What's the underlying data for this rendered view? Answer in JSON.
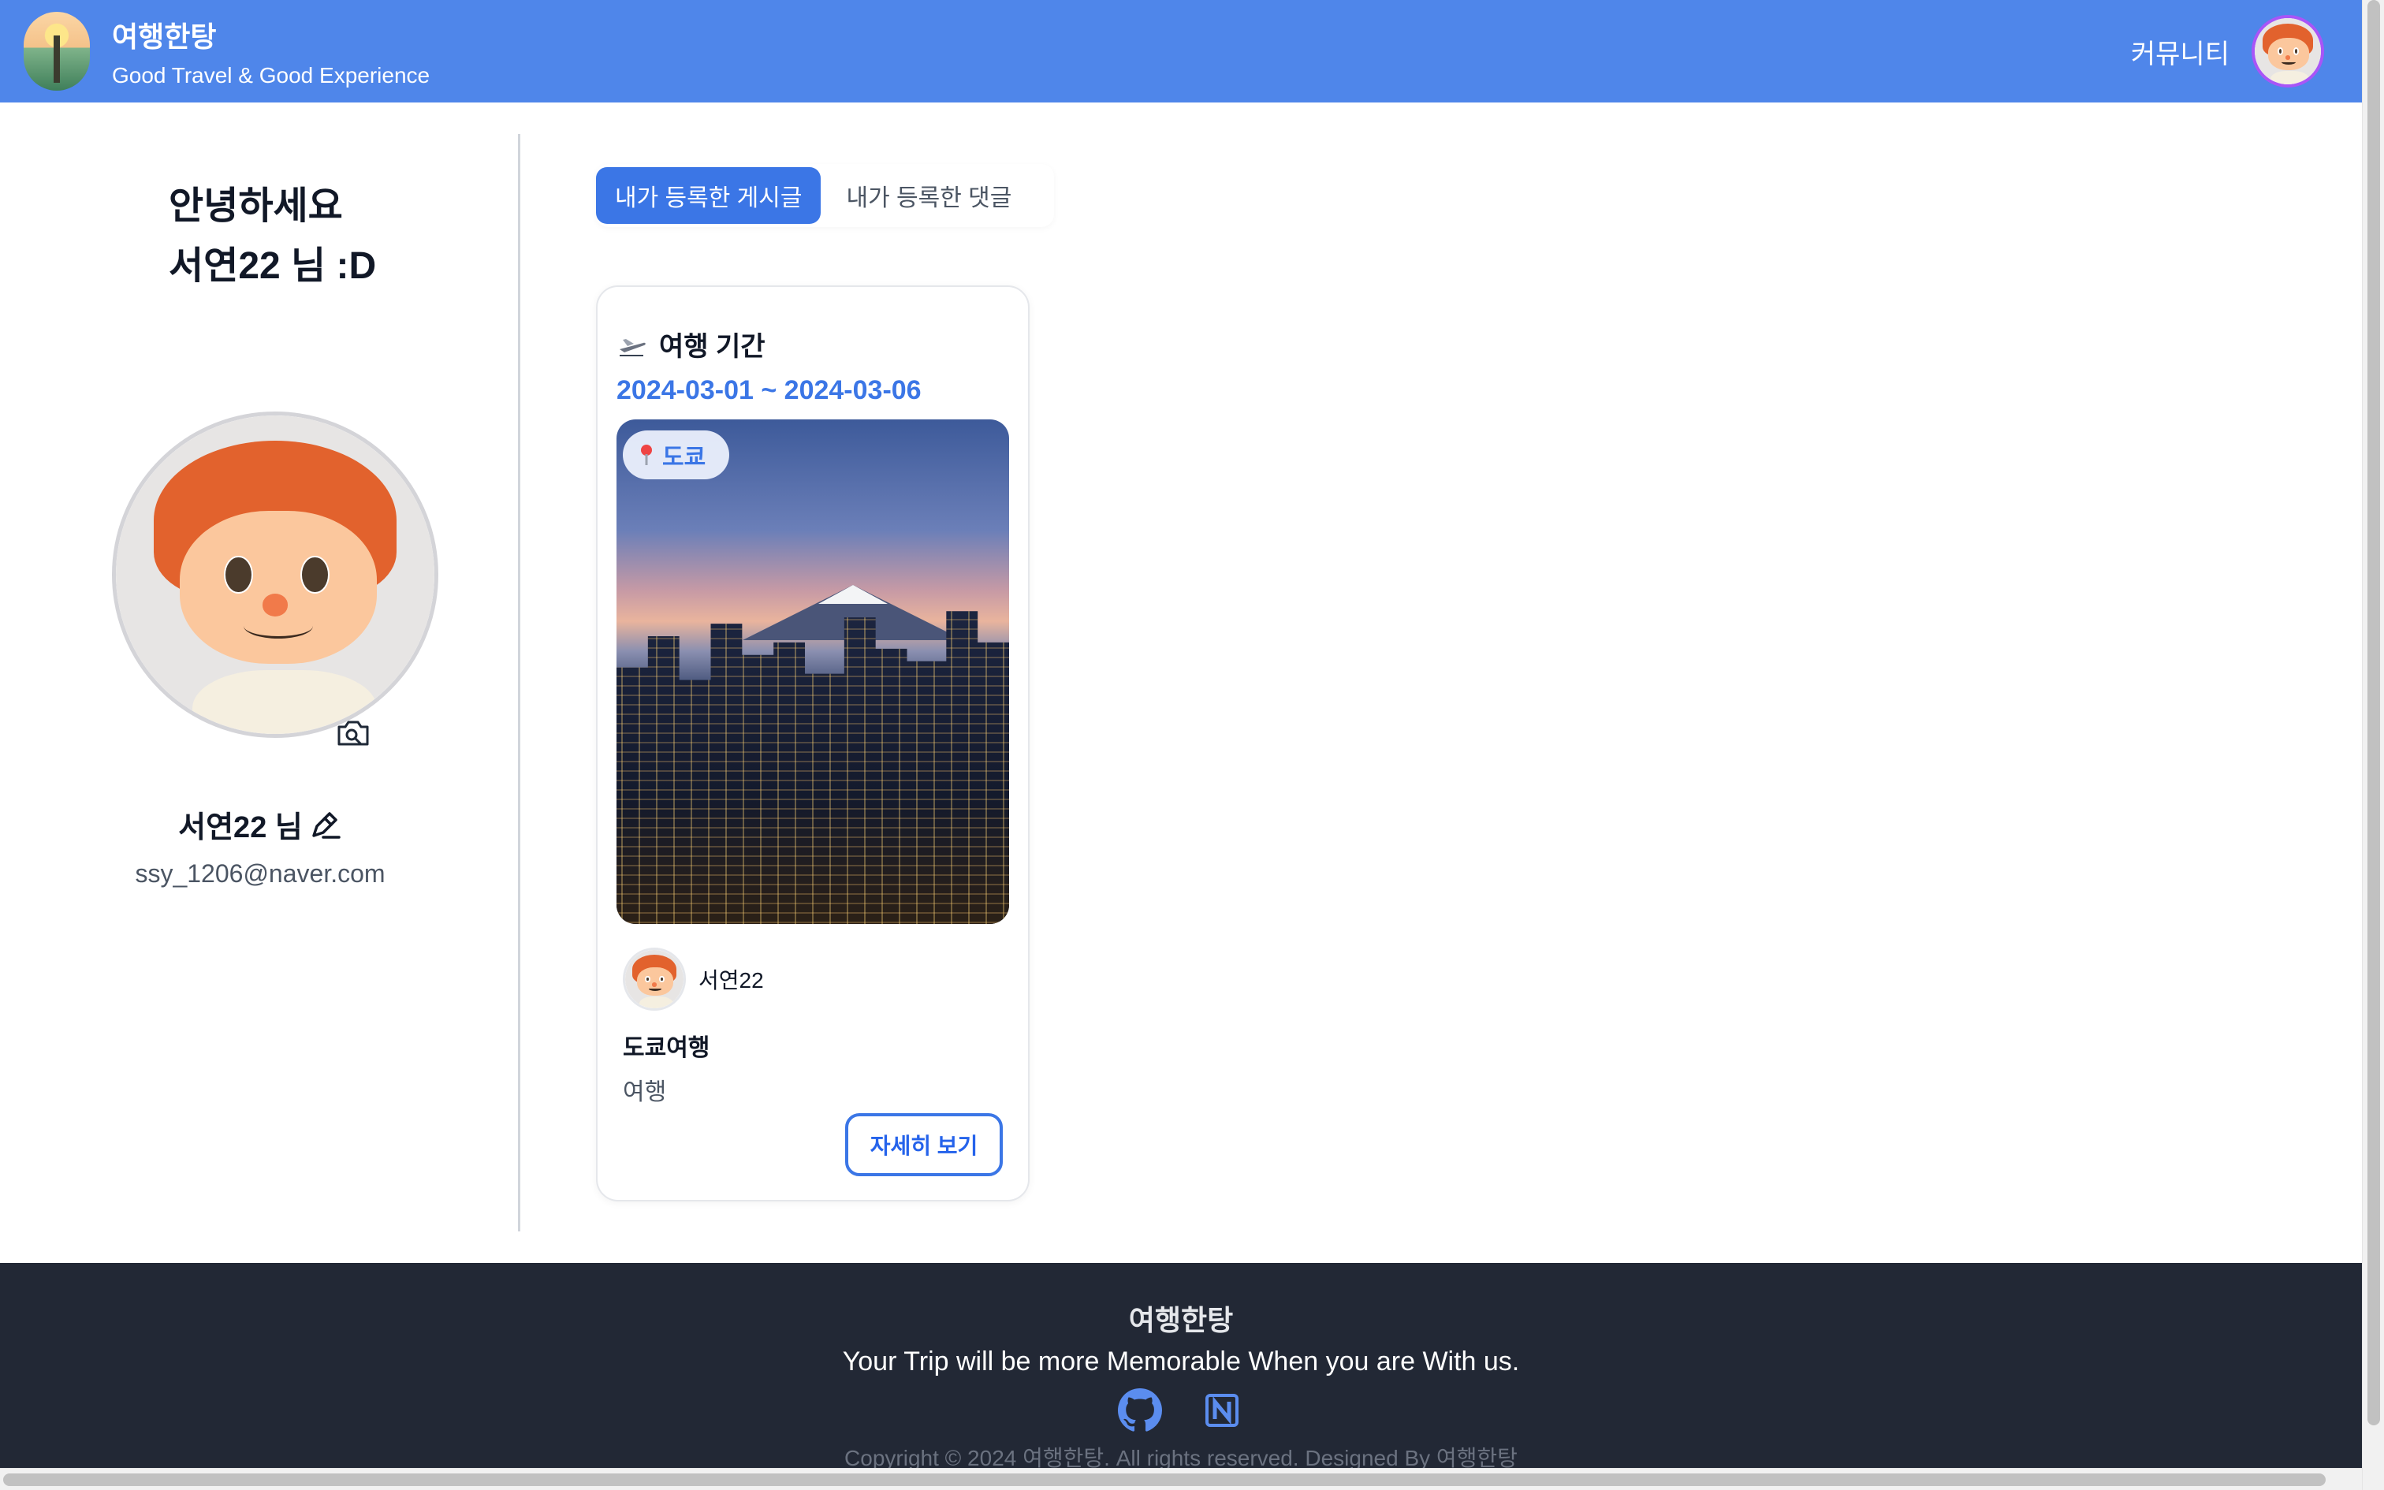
{
  "header": {
    "brand_title": "여행한탕",
    "brand_subtitle": "Good Travel & Good Experience",
    "community_label": "커뮤니티",
    "bg_color": "#4f86ea"
  },
  "profile": {
    "greeting_line1": "안녕하세요",
    "greeting_line2": "서연22 님 :D",
    "nickname": "서연22 님",
    "email": "ssy_1206@naver.com",
    "camera_icon": "camera-search-icon",
    "edit_icon": "pencil-icon"
  },
  "tabs": [
    {
      "label": "내가 등록한 게시글",
      "active": true
    },
    {
      "label": "내가 등록한 댓글",
      "active": false
    }
  ],
  "post": {
    "period_label": "여행 기간",
    "period_dates": "2024-03-01 ~ 2024-03-06",
    "location": "도쿄",
    "author": "서연22",
    "title": "도쿄여행",
    "category": "여행",
    "detail_button": "자세히 보기"
  },
  "footer": {
    "title": "여행한탕",
    "tagline": "Your Trip will be more Memorable When you are With us.",
    "copyright": "Copyright © 2024 여행한탕. All rights reserved. Designed By 여행한탕",
    "icons": [
      "github-icon",
      "notion-icon"
    ]
  },
  "colors": {
    "accent": "#3b76e6",
    "footer_bg": "#222835"
  }
}
